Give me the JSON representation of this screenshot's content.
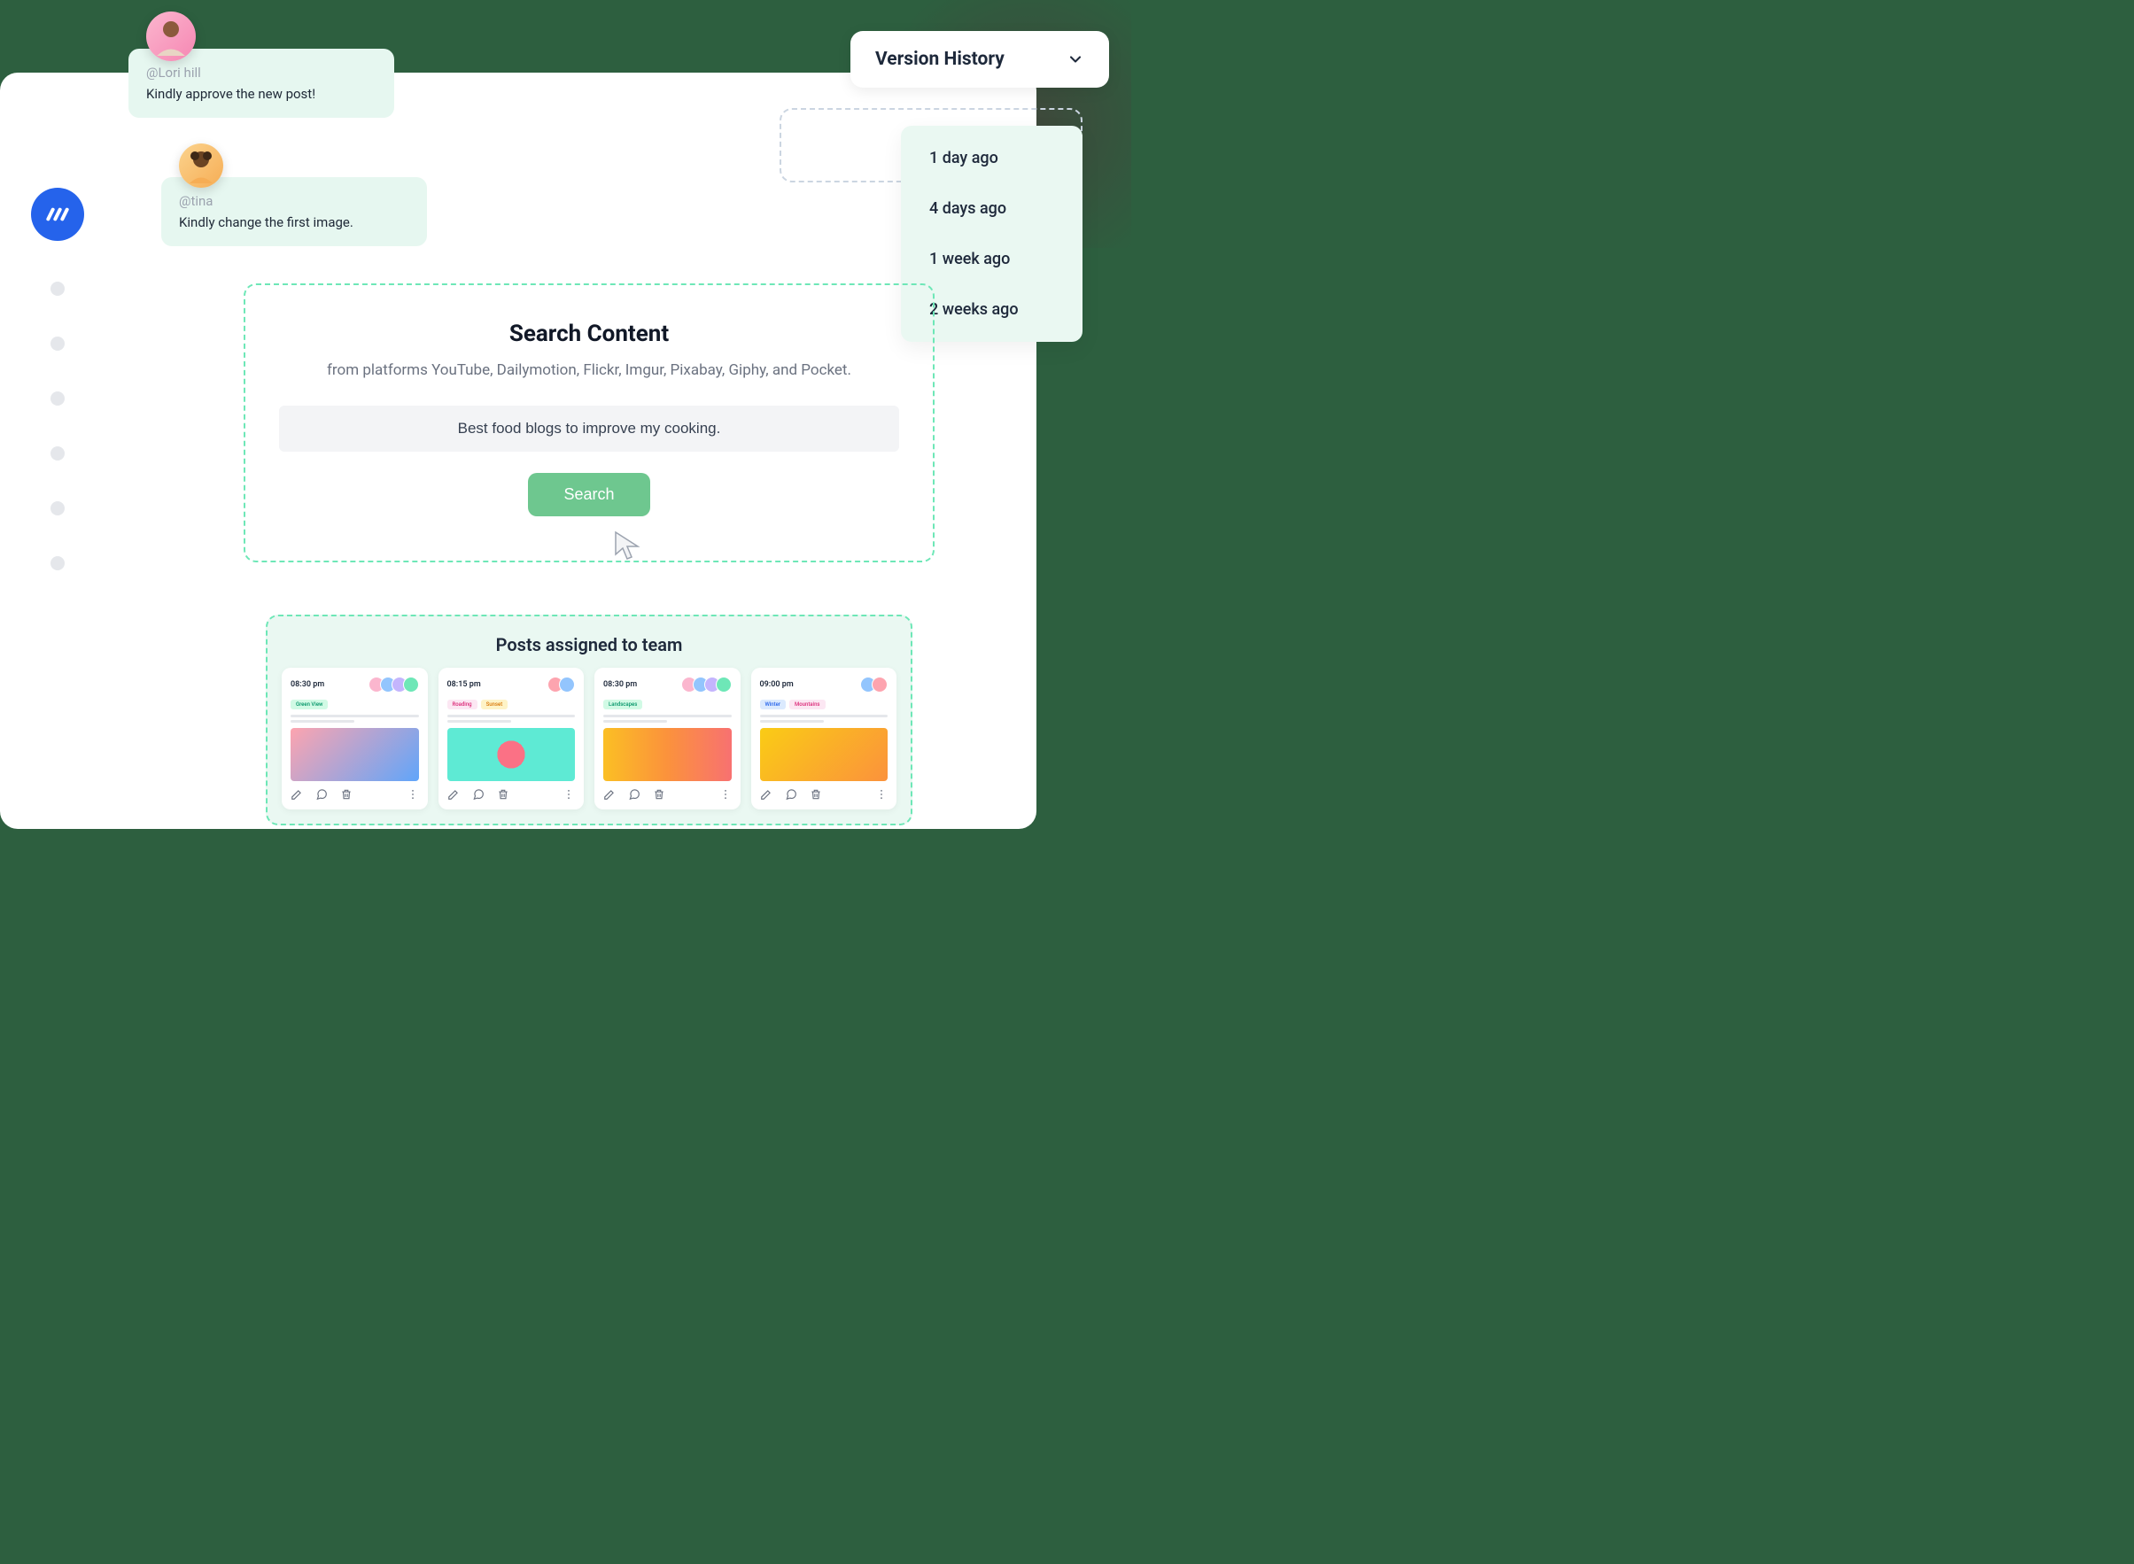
{
  "comments": [
    {
      "user": "@Lori hill",
      "text": "Kindly approve the new post!"
    },
    {
      "user": "@tina",
      "text": "Kindly change the first image."
    }
  ],
  "version": {
    "title": "Version History",
    "items": [
      "1 day ago",
      "4 days ago",
      "1 week ago",
      "2 weeks ago"
    ]
  },
  "search": {
    "title": "Search Content",
    "subtitle": "from platforms YouTube, Dailymotion, Flickr, Imgur, Pixabay, Giphy, and Pocket.",
    "value": "Best food blogs to improve my cooking.",
    "button": "Search"
  },
  "posts": {
    "title": "Posts assigned to team",
    "cards": [
      {
        "time": "08:30 pm",
        "tags": [
          {
            "label": "Green View",
            "style": "green"
          }
        ]
      },
      {
        "time": "08:15 pm",
        "tags": [
          {
            "label": "Roading",
            "style": "pink"
          },
          {
            "label": "Sunset",
            "style": "yellow"
          }
        ]
      },
      {
        "time": "08:30 pm",
        "tags": [
          {
            "label": "Landscapes",
            "style": "green"
          }
        ]
      },
      {
        "time": "09:00 pm",
        "tags": [
          {
            "label": "Winter",
            "style": "blue"
          },
          {
            "label": "Mountains",
            "style": "pink"
          }
        ]
      }
    ]
  }
}
